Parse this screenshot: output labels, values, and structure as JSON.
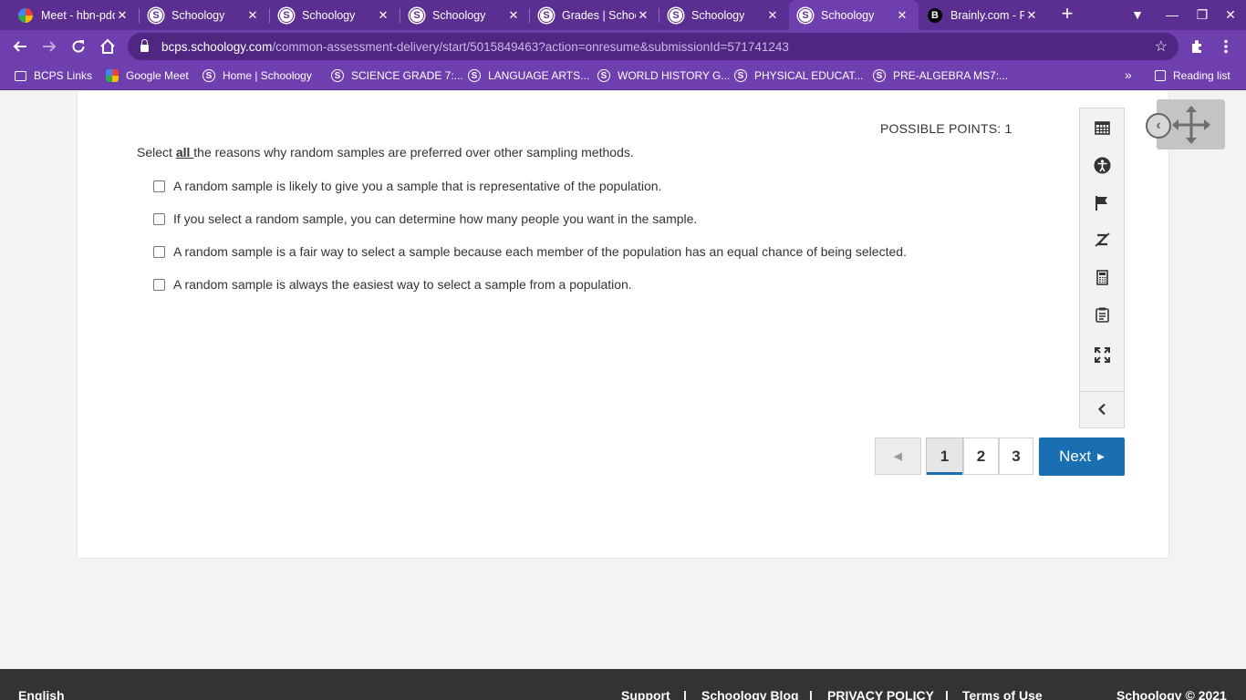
{
  "browser": {
    "tabs": [
      {
        "title": "Meet - hbn-pdq",
        "favicon": "meet"
      },
      {
        "title": "Schoology",
        "favicon": "schoology"
      },
      {
        "title": "Schoology",
        "favicon": "schoology"
      },
      {
        "title": "Schoology",
        "favicon": "schoology"
      },
      {
        "title": "Grades | Schoology",
        "favicon": "schoology"
      },
      {
        "title": "Schoology",
        "favicon": "schoology"
      },
      {
        "title": "Schoology",
        "favicon": "schoology",
        "active": true
      },
      {
        "title": "Brainly.com - F",
        "favicon": "brainly"
      }
    ],
    "url_host": "bcps.schoology.com",
    "url_path": "/common-assessment-delivery/start/5015849463?action=onresume&submissionId=571741243",
    "bookmarks": [
      {
        "label": "BCPS Links",
        "icon": "folder"
      },
      {
        "label": "Google Meet",
        "icon": "meet"
      },
      {
        "label": "Home | Schoology",
        "icon": "schoology"
      },
      {
        "label": "SCIENCE GRADE 7:...",
        "icon": "schoology"
      },
      {
        "label": "LANGUAGE ARTS...",
        "icon": "schoology"
      },
      {
        "label": "WORLD HISTORY G...",
        "icon": "schoology"
      },
      {
        "label": "PHYSICAL EDUCAT...",
        "icon": "schoology"
      },
      {
        "label": "PRE-ALGEBRA MS7:...",
        "icon": "schoology"
      }
    ],
    "more_bookmarks": "»",
    "reading_list": "Reading list",
    "accent": "#6f3fb0"
  },
  "question": {
    "points_label": "POSSIBLE POINTS: 1",
    "prompt_before": "Select ",
    "prompt_emphasis": "all ",
    "prompt_after": "the reasons why random samples are preferred over other sampling methods.",
    "choices": [
      "A random sample is likely to give you a sample that is representative of the population.",
      "If you select a random sample, you can determine how many people you want in the sample.",
      "A random sample is a fair way to select a sample because each member of the population has an equal chance of being selected.",
      "A random sample is always the easiest way to select a sample from a population."
    ]
  },
  "tools": [
    "calendar-grid-icon",
    "accessibility-icon",
    "flag-icon",
    "eliminate-icon",
    "calculator-icon",
    "notepad-icon",
    "fullscreen-icon",
    "chevron-left-icon"
  ],
  "pager": {
    "prev": "◀",
    "pages": [
      "1",
      "2",
      "3"
    ],
    "current_page": "1",
    "next_label": "Next",
    "next_arrow": "▶",
    "accent": "#1a6fb3"
  },
  "footer": {
    "language": "English",
    "links": [
      "Support",
      "Schoology Blog",
      "PRIVACY POLICY",
      "Terms of Use"
    ],
    "separator": "|",
    "copyright": "Schoology © 2021"
  }
}
